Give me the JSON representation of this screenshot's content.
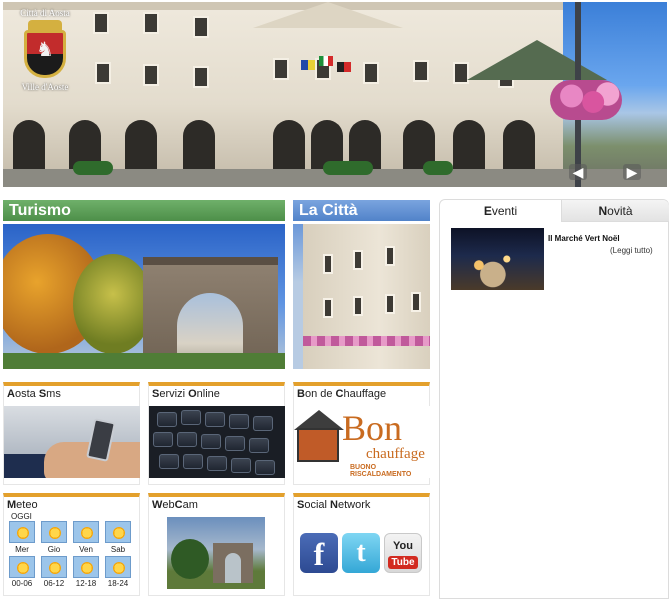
{
  "header": {
    "crest_top": "Città di Aosta",
    "crest_bottom": "Ville d'Aoste"
  },
  "panels": {
    "turismo": {
      "title": "Turismo"
    },
    "citta": {
      "title": "La Città"
    }
  },
  "tiles": {
    "aosta_sms": {
      "title_first": "A",
      "title_rest": "osta ",
      "title_first2": "S",
      "title_rest2": "ms"
    },
    "servizi_online": {
      "title_first": "S",
      "title_rest": "ervizi ",
      "title_first2": "O",
      "title_rest2": "nline"
    },
    "bon_de_chauffage": {
      "title_first": "B",
      "title_rest": "on de ",
      "title_first2": "C",
      "title_rest2": "hauffage",
      "img_big": "Bon",
      "img_small": "chauffage",
      "img_sub": "BUONO RISCALDAMENTO"
    },
    "meteo": {
      "title_first": "M",
      "title_rest": "eteo",
      "today_label": "OGGI",
      "days": [
        "Mer",
        "Gio",
        "Ven",
        "Sab"
      ],
      "slots": [
        "00-06",
        "06-12",
        "12-18",
        "18-24"
      ]
    },
    "webcam": {
      "title_first": "W",
      "title_rest": "eb",
      "title_first2": "C",
      "title_rest2": "am"
    },
    "social": {
      "title_first": "S",
      "title_rest": "ocial ",
      "title_first2": "N",
      "title_rest2": "etwork",
      "facebook": "f",
      "twitter": "t",
      "youtube_you": "You",
      "youtube_tube": "Tube"
    }
  },
  "sidebar": {
    "tabs": [
      {
        "first": "E",
        "rest": "venti",
        "active": true
      },
      {
        "first": "N",
        "rest": "ovità",
        "active": false
      }
    ],
    "event": {
      "title": "Il Marché Vert Noël",
      "more": "(Leggi tutto)"
    }
  }
}
